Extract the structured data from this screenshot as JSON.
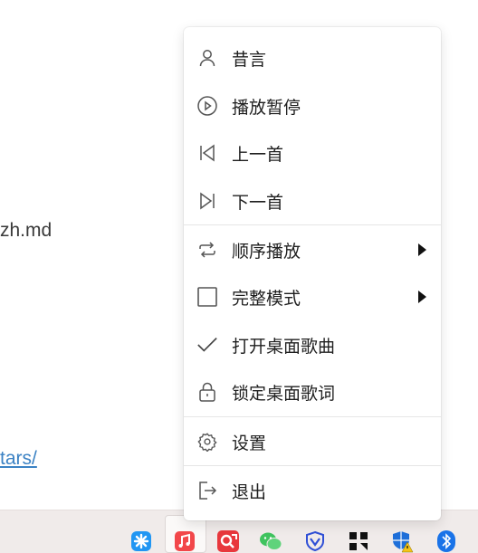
{
  "background": {
    "file_text": "zh.md",
    "link_text": "tars/"
  },
  "menu": {
    "items": [
      {
        "label": "昔言",
        "icon": "user-icon"
      },
      {
        "label": "播放暂停",
        "icon": "play-circle-icon"
      },
      {
        "label": "上一首",
        "icon": "skip-previous-icon"
      },
      {
        "label": "下一首",
        "icon": "skip-next-icon"
      },
      {
        "label": "顺序播放",
        "icon": "repeat-icon",
        "submenu": true
      },
      {
        "label": "完整模式",
        "icon": "checkbox-icon",
        "submenu": true
      },
      {
        "label": "打开桌面歌曲",
        "icon": "checkmark-icon"
      },
      {
        "label": "锁定桌面歌词",
        "icon": "lock-icon"
      },
      {
        "label": "设置",
        "icon": "gear-icon"
      },
      {
        "label": "退出",
        "icon": "exit-icon"
      }
    ]
  },
  "taskbar": {
    "icons": [
      "assistant-icon",
      "music-app-icon",
      "screenshot-app-icon",
      "wechat-icon",
      "security-shield-icon",
      "grid-app-icon",
      "windows-security-warning-icon",
      "bluetooth-icon"
    ],
    "colors": {
      "music_app": "#f2474a",
      "screenshot_app": "#e8383d",
      "wechat": "#3fc35e",
      "shield": "#2f4fd6",
      "bluetooth": "#1a73e8",
      "assistant": "#2196f3"
    }
  }
}
